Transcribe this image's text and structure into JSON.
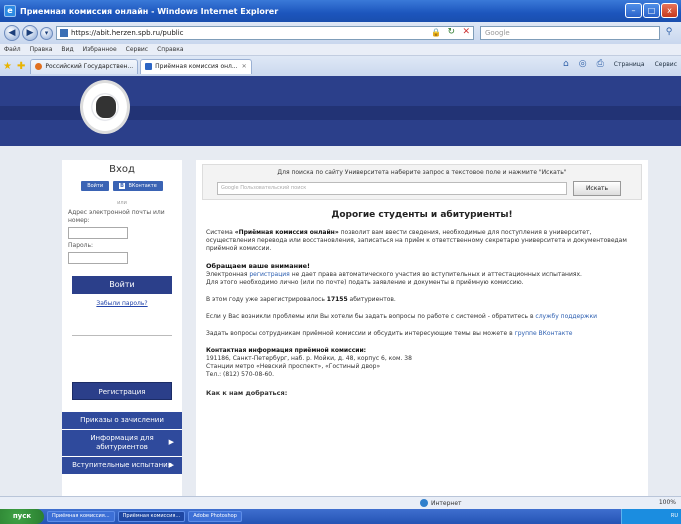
{
  "window": {
    "title": "Приемная комиссия онлайн - Windows Internet Explorer",
    "minimize": "–",
    "maximize": "□",
    "close": "x"
  },
  "addressbar": {
    "url": "https://abit.herzen.spb.ru/public",
    "search_placeholder": "Google"
  },
  "menubar": [
    "Файл",
    "Правка",
    "Вид",
    "Избранное",
    "Сервис",
    "Справка"
  ],
  "tabs": [
    {
      "label": "Российский Государствен..."
    },
    {
      "label": "Приёмная комиссия онл..."
    }
  ],
  "tabtools": {
    "page": "Страница",
    "service": "Сервис"
  },
  "sidebar": {
    "title": "Вход",
    "login_btn": "Войти",
    "vk_btn": "ВКонтакте",
    "vk_letter": "В",
    "or_text": "или",
    "email_label": "Адрес электронной почты или номер:",
    "password_label": "Пароль:",
    "submit_label": "Войти",
    "forgot_label": "Забыли пароль?",
    "register_label": "Регистрация",
    "menu": [
      {
        "label": "Приказы о зачислении"
      },
      {
        "label": "Информация для абитуриентов"
      },
      {
        "label": "Вступительные испытания"
      }
    ]
  },
  "main": {
    "search_hint": "Для поиска по сайту Университета наберите запрос в текстовое поле и нажмите \"Искать\"",
    "search_placeholder": "Google Пользовательский поиск",
    "search_button": "Искать",
    "heading": "Дорогие студенты и абитуриенты!",
    "intro_pre": "Система ",
    "intro_bold": "«Приёмная комиссия онлайн»",
    "intro_post": " позволит вам ввести сведения, необходимые для поступления в университет, осуществления перевода или восстановления, записаться на приём к ответственному секретарю университета и документоведам приёмной комиссии.",
    "attention_title": "Обращаем ваше внимание!",
    "attention_p1_pre": "Электронная ",
    "attention_p1_link": "регистрация",
    "attention_p1_post": " не дает права автоматического участия во вступительных и аттестационных испытаниях.",
    "attention_p2": "Для этого необходимо лично (или по почте) подать заявление и документы в приёмную комиссию.",
    "registered_pre": "В этом году уже зарегистрировалось ",
    "registered_count": "17155",
    "registered_post": " абитуриентов.",
    "support_pre": "Если у Вас возникли проблемы или Вы хотели бы задать вопросы по работе с системой - обратитесь в ",
    "support_link": "службу поддержки",
    "vk_pre": "Задать вопросы сотрудникам приёмной комиссии и обсудить интересующие темы вы можете в ",
    "vk_link": "группе ВКонтакте",
    "contact_title": "Контактная информация приёмной комиссии:",
    "contact_address": "191186, Санкт-Петербург, наб. р. Мойки, д. 48, корпус 6, ком. 38",
    "contact_metro": "Станции метро «Невский проспект», «Гостиный двор»",
    "contact_phone": "Тел.: (812) 570-08-60.",
    "how_to_get": "Как к нам добраться:"
  },
  "statusbar": {
    "zone": "Интернет",
    "zoom": "100%"
  },
  "taskbar": {
    "start": "пуск",
    "items": [
      "Приёмная комиссия...",
      "Приёмная комиссия...",
      "Adobe Photoshop"
    ],
    "lang": "RU"
  }
}
